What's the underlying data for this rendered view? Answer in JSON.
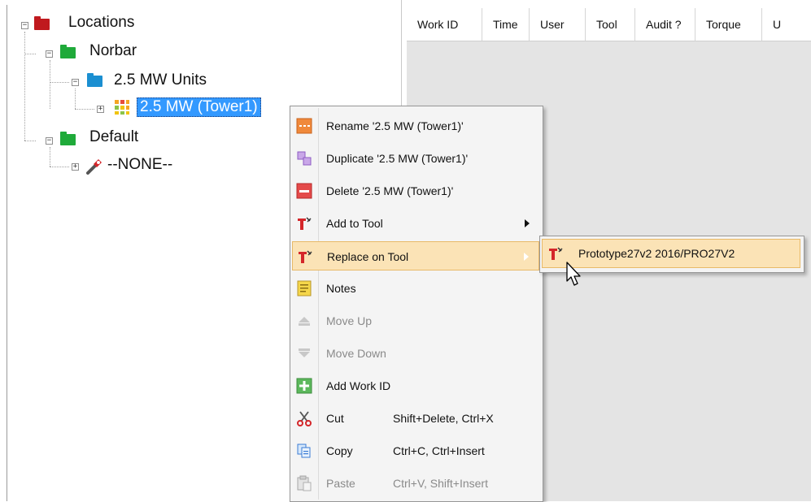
{
  "tree": {
    "root": {
      "label": "Locations",
      "expander": "−",
      "color": "#c0191e"
    },
    "norbar": {
      "label": "Norbar",
      "expander": "−",
      "color": "#1faa3a"
    },
    "units": {
      "label": "2.5 MW Units",
      "expander": "−",
      "color": "#1b8fd1"
    },
    "tower": {
      "label": "2.5 MW (Tower1)",
      "expander": "+",
      "selected": true
    },
    "default": {
      "label": "Default",
      "expander": "−",
      "color": "#1faa3a"
    },
    "none": {
      "label": "--NONE--",
      "expander": "+",
      "icon": "wrench-icon"
    }
  },
  "grid": {
    "columns": [
      "Work ID",
      "Time",
      "User",
      "Tool",
      "Audit ?",
      "Torque",
      "U"
    ]
  },
  "context_menu": {
    "items": [
      {
        "label": "Rename '2.5 MW (Tower1)'",
        "icon": "rename-icon",
        "enabled": true
      },
      {
        "label": "Duplicate '2.5 MW (Tower1)'",
        "icon": "duplicate-icon",
        "enabled": true
      },
      {
        "label": "Delete '2.5 MW (Tower1)'",
        "icon": "delete-icon",
        "enabled": true
      },
      {
        "label": "Add to Tool",
        "icon": "tool-icon",
        "enabled": true,
        "submenu": true
      },
      {
        "label": "Replace on Tool",
        "icon": "tool-icon",
        "enabled": true,
        "submenu": true,
        "highlighted": true
      },
      {
        "label": "Notes",
        "icon": "notes-icon",
        "enabled": true
      },
      {
        "label": "Move Up",
        "icon": "move-up-icon",
        "enabled": false
      },
      {
        "label": "Move Down",
        "icon": "move-down-icon",
        "enabled": false
      },
      {
        "label": "Add Work ID",
        "icon": "add-icon",
        "enabled": true
      },
      {
        "label": "Cut",
        "shortcut": "Shift+Delete, Ctrl+X",
        "icon": "scissors-icon",
        "enabled": true
      },
      {
        "label": "Copy",
        "shortcut": "Ctrl+C, Ctrl+Insert",
        "icon": "copy-icon",
        "enabled": true
      },
      {
        "label": "Paste",
        "shortcut": "Ctrl+V, Shift+Insert",
        "icon": "paste-icon",
        "enabled": false
      }
    ]
  },
  "submenu": {
    "item": {
      "label": "Prototype27v2 2016/PRO27V2",
      "icon": "tool-icon"
    }
  },
  "colors": {
    "selection": "#3399ff",
    "menu_highlight": "#fbe3b6",
    "menu_highlight_border": "#e8b968"
  }
}
